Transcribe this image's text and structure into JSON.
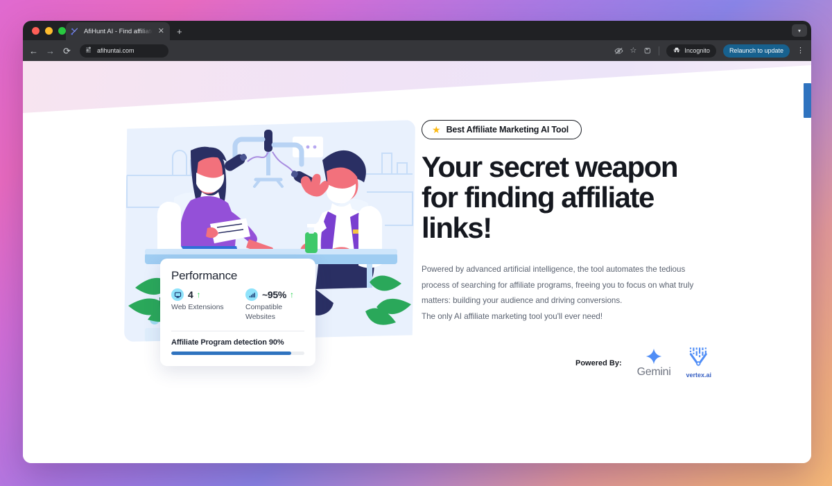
{
  "browser": {
    "tab": {
      "title": "AfiHunt AI - Find affiliate links",
      "favicon_icon": "afihunt-logo-icon",
      "close_icon": "close-icon",
      "close_glyph": "✕"
    },
    "new_tab_glyph": "+",
    "window_chevron_glyph": "▾",
    "nav": {
      "back_glyph": "←",
      "forward_glyph": "→",
      "reload_glyph": "⟳"
    },
    "omnibox": {
      "url": "afihuntai.com",
      "site_settings_icon": "tune-icon"
    },
    "actions": {
      "tracking_protection_glyph": "⊘",
      "bookmark_glyph": "☆",
      "extensions_glyph": "⧉",
      "incognito_label": "Incognito",
      "incognito_icon": "incognito-hat-icon",
      "relaunch_label": "Relaunch to update",
      "menu_glyph": "⋮"
    }
  },
  "hero": {
    "badge": {
      "star_glyph": "★",
      "text": "Best Affiliate Marketing AI Tool"
    },
    "headline": "Your secret weapon for finding affiliate links!",
    "paragraph": "Powered by advanced artificial intelligence, the tool automates the tedious process of searching for affiliate programs, freeing you to focus on what truly matters: building your audience and driving conversions.",
    "paragraph_line2": "The only AI affiliate marketing tool you'll ever need!",
    "powered_by": {
      "label": "Powered By:",
      "logos": [
        {
          "name": "Gemini",
          "icon": "gemini-sparkle-icon"
        },
        {
          "name": "vertex.ai",
          "icon": "vertex-ai-icon"
        }
      ]
    }
  },
  "performance_card": {
    "title": "Performance",
    "stats": [
      {
        "icon": "monitor-icon",
        "value": "4",
        "trend_glyph": "↑",
        "label": "Web Extensions"
      },
      {
        "icon": "signal-bars-icon",
        "value": "~95%",
        "trend_glyph": "↑",
        "label": "Compatible Websites"
      }
    ],
    "detection": {
      "label": "Affiliate Program detection 90%",
      "percent": 90
    }
  },
  "colors": {
    "accent_blue": "#2f73bf",
    "trend_green": "#27d34f",
    "badge_star_yellow": "#fcb913",
    "stat_badge_cyan": "#8fe3fb",
    "illustration_bg": "#e9f1fd"
  }
}
